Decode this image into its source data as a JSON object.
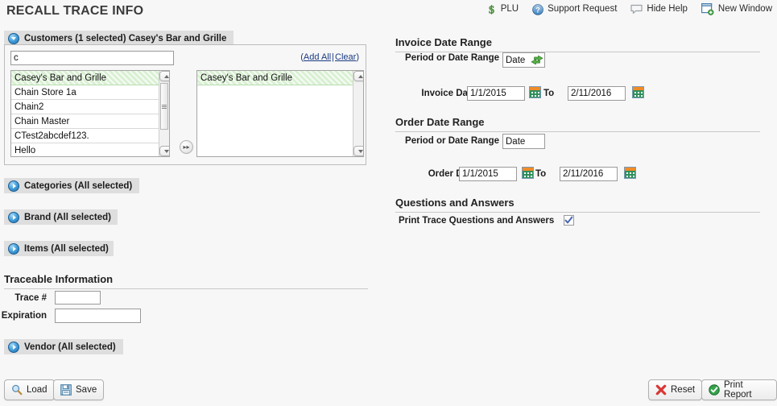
{
  "page": {
    "title": "RECALL TRACE INFO"
  },
  "toolbar": {
    "items": [
      {
        "label": "PLU",
        "icon": "dollar-icon"
      },
      {
        "label": "Support Request",
        "icon": "question-circle-icon"
      },
      {
        "label": "Hide Help",
        "icon": "speech-bubble-icon"
      },
      {
        "label": "New Window",
        "icon": "new-window-icon"
      }
    ]
  },
  "customers": {
    "header": "Customers (1 selected) Casey's Bar and Grille",
    "filter_value": "c",
    "filter_placeholder": "",
    "add_all": "Add All",
    "separator": "|",
    "clear": "Clear",
    "open_paren": "(",
    "close_paren": ")",
    "move_glyph": "▸▸",
    "available": [
      {
        "label": "Casey's Bar and Grille",
        "selected": true
      },
      {
        "label": "Chain Store 1a",
        "selected": false
      },
      {
        "label": "Chain2",
        "selected": false
      },
      {
        "label": "Chain Master",
        "selected": false
      },
      {
        "label": "CTest2abcdef123.",
        "selected": false
      },
      {
        "label": "Hello",
        "selected": false
      }
    ],
    "selected": [
      {
        "label": "Casey's Bar and Grille",
        "selected": true
      }
    ]
  },
  "sections": {
    "categories": "Categories (All selected)",
    "brand": "Brand (All selected)",
    "items": "Items (All selected)",
    "vendor": "Vendor (All selected)"
  },
  "traceable": {
    "title": "Traceable Information",
    "trace_label": "Trace #",
    "trace_value": "",
    "expiration_label": "Expiration",
    "expiration_value": ""
  },
  "invoice": {
    "title": "Invoice Date Range",
    "period_label": "Period or Date Range",
    "period_value": "Date",
    "date_label": "Invoice Date:",
    "from_value": "1/1/2015",
    "to_label": "To",
    "to_value": "2/11/2016"
  },
  "order": {
    "title": "Order Date Range",
    "period_label": "Period or Date Range",
    "period_value": "Date",
    "date_label": "Order Date:",
    "from_value": "1/1/2015",
    "to_label": "To",
    "to_value": "2/11/2016"
  },
  "questions": {
    "title": "Questions and Answers",
    "print_label": "Print Trace Questions and Answers",
    "print_checked": true
  },
  "footer": {
    "load": "Load",
    "save": "Save",
    "reset": "Reset",
    "print_report": "Print Report"
  },
  "colors": {
    "page_bg": "#f7f7f7",
    "section_bar": "#dedede",
    "selected_row_green": "#d9f0d2",
    "link_blue": "#1a3a82",
    "disclosure_blue": "#1b6fae",
    "accent_orange": "#f08b28",
    "accent_green": "#2f8f5b",
    "reset_red": "#d93636",
    "print_green": "#2a9e3f"
  }
}
